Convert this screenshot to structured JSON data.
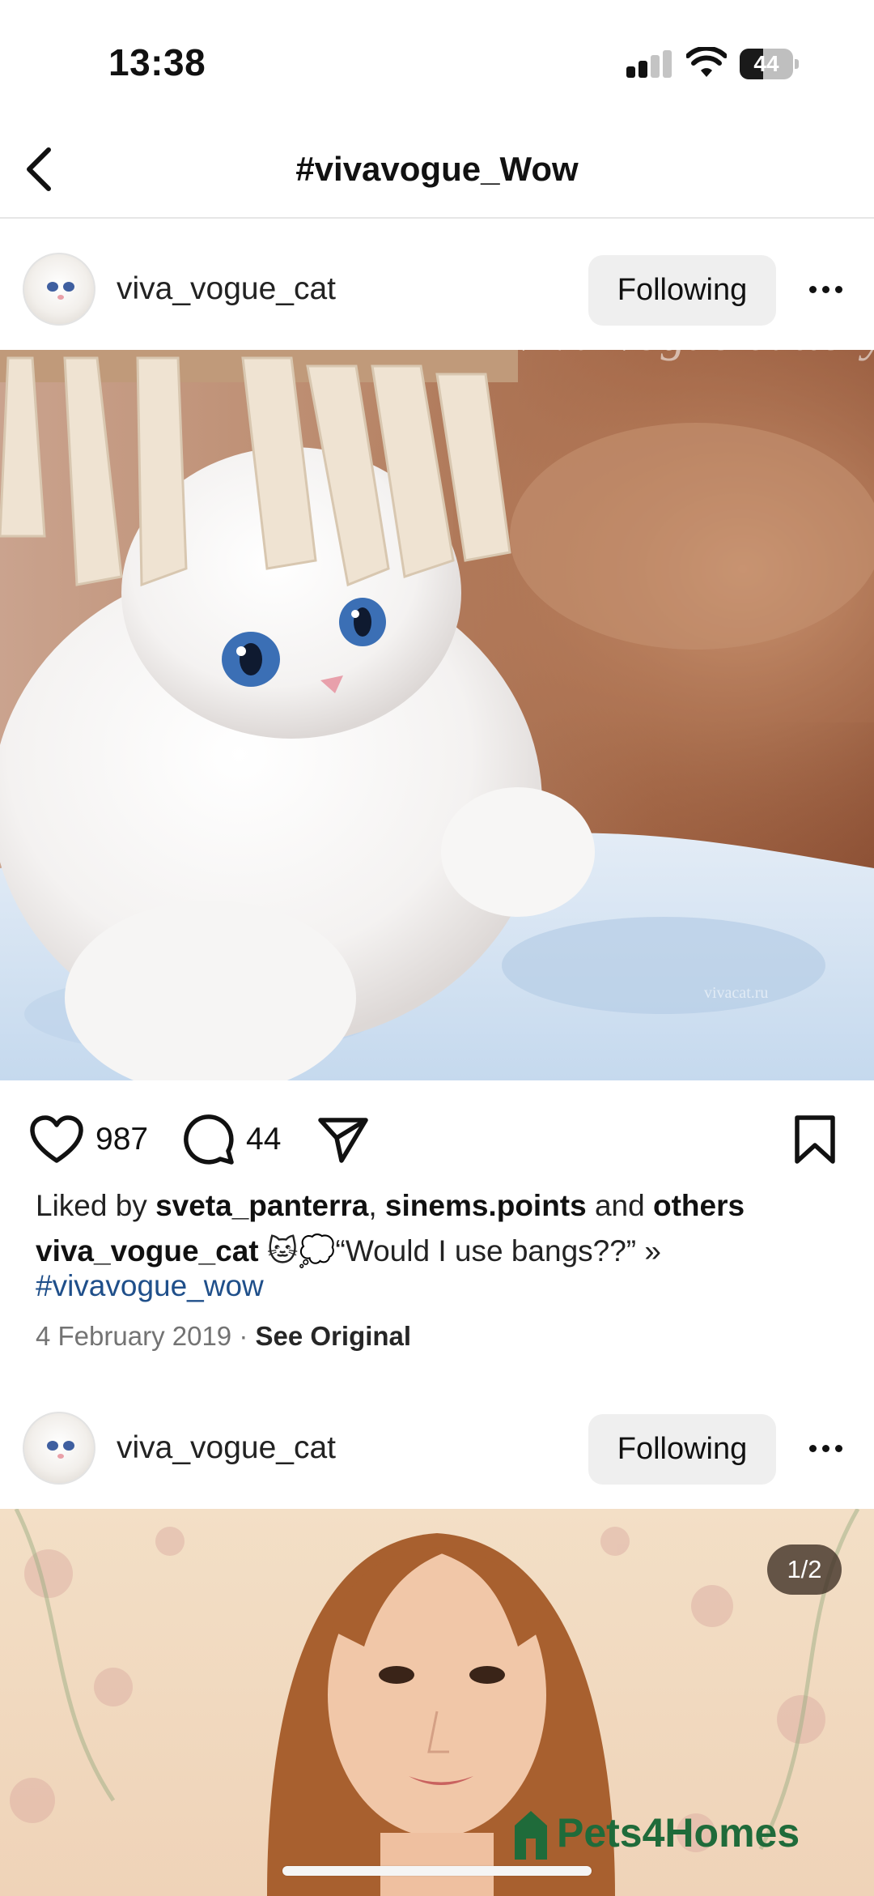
{
  "status_bar": {
    "time": "13:38",
    "battery": "44",
    "battery_level": 0.44
  },
  "header": {
    "title": "#vivavogue_Wow"
  },
  "posts": [
    {
      "username": "viva_vogue_cat",
      "follow_label": "Following",
      "image_watermark": "Viva Vogue cattery",
      "image_watermark_url": "vivacat.ru",
      "likes": "987",
      "comments": "44",
      "liked_by_prefix": "Liked by",
      "liked_by_user1": "sveta_panterra",
      "liked_by_sep": ",",
      "liked_by_user2": "sinems.points",
      "liked_by_and": "and",
      "liked_by_others": "others",
      "caption_user": "viva_vogue_cat",
      "caption_text": "🐱💭“Would I use bangs??” »",
      "hashtag": "#vivavogue_wow",
      "date": "4 February 2019",
      "date_sep": "·",
      "see_original": "See Original"
    },
    {
      "username": "viva_vogue_cat",
      "follow_label": "Following",
      "page_counter": "1/2",
      "brand_watermark": "Pets4Homes"
    }
  ],
  "icons": {
    "back": "chevron-left-icon",
    "more": "more-horizontal-icon",
    "like": "heart-icon",
    "comment": "comment-icon",
    "share": "send-icon",
    "save": "bookmark-icon"
  }
}
